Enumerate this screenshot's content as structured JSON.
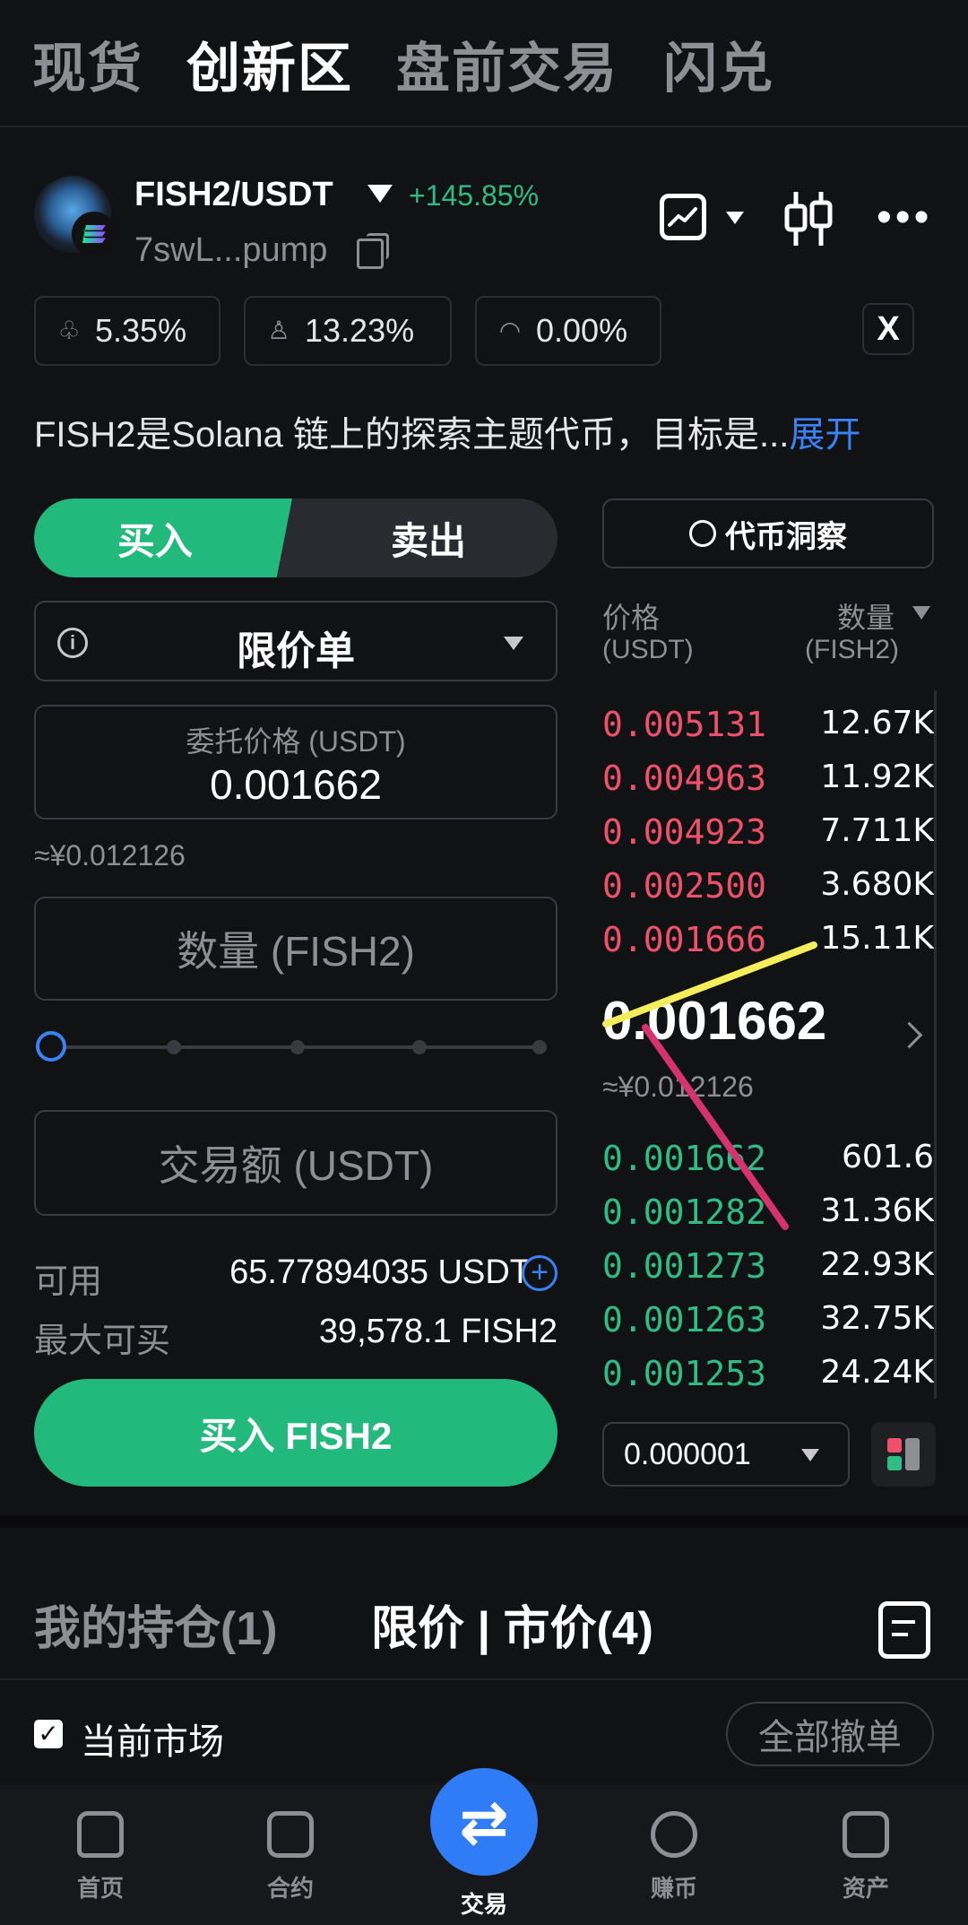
{
  "topnav": {
    "tabs": [
      "现货",
      "创新区",
      "盘前交易",
      "闪兑"
    ],
    "active": "创新区"
  },
  "token": {
    "pair": "FISH2/USDT",
    "change": "+145.85%",
    "address": "7swL...pump",
    "stats": [
      "5.35%",
      "13.23%",
      "0.00%"
    ],
    "social": "X",
    "description": "FISH2是Solana 链上的探索主题代币，目标是...",
    "expand": "展开"
  },
  "trade": {
    "buy_label": "买入",
    "sell_label": "卖出",
    "order_type": "限价单",
    "price_label": "委托价格 (USDT)",
    "price_value": "0.001662",
    "price_approx": "≈¥0.012126",
    "qty_placeholder": "数量 (FISH2)",
    "amount_placeholder": "交易额 (USDT)",
    "slider_percent": 0,
    "available_label": "可用",
    "available_value": "65.77894035 USDT",
    "max_label": "最大可买",
    "max_value": "39,578.1 FISH2",
    "submit_label": "买入 FISH2"
  },
  "orderbook": {
    "insight_label": "代币洞察",
    "price_header": "价格",
    "price_unit": "(USDT)",
    "qty_header": "数量",
    "qty_unit": "(FISH2)",
    "asks": [
      {
        "price": "0.005131",
        "qty": "12.67K"
      },
      {
        "price": "0.004963",
        "qty": "11.92K"
      },
      {
        "price": "0.004923",
        "qty": "7.711K"
      },
      {
        "price": "0.002500",
        "qty": "3.680K"
      },
      {
        "price": "0.001666",
        "qty": "15.11K"
      }
    ],
    "last_price": "0.001662",
    "last_approx": "≈¥0.012126",
    "bids": [
      {
        "price": "0.001662",
        "qty": "601.6"
      },
      {
        "price": "0.001282",
        "qty": "31.36K"
      },
      {
        "price": "0.001273",
        "qty": "22.93K"
      },
      {
        "price": "0.001263",
        "qty": "32.75K"
      },
      {
        "price": "0.001253",
        "qty": "24.24K"
      }
    ],
    "depth_step": "0.000001"
  },
  "bottom": {
    "positions_tab": "我的持仓(1)",
    "orders_tab": "限价 | 市价(4)",
    "current_market": "当前市场",
    "cancel_all": "全部撤单"
  },
  "tabbar": [
    "首页",
    "合约",
    "交易",
    "赚币",
    "资产"
  ],
  "colors": {
    "buy": "#22b97c",
    "ask": "#f0516a",
    "bid": "#2ebd85",
    "accent": "#3b82f6",
    "annotation_yellow": "#f4ee5a",
    "annotation_pink": "#d6336c"
  }
}
